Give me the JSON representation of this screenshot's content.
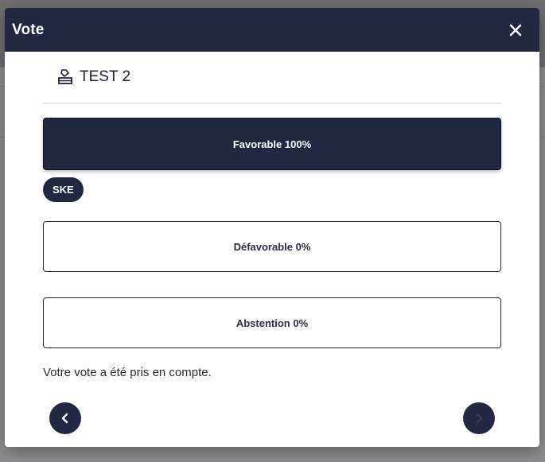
{
  "dialog": {
    "title": "Vote",
    "close_icon": "close-icon"
  },
  "question": {
    "icon": "ballot-box-icon",
    "title": "TEST 2"
  },
  "options": [
    {
      "label": "Favorable 100%",
      "selected": true
    },
    {
      "label": "Défavorable 0%",
      "selected": false
    },
    {
      "label": "Abstention 0%",
      "selected": false
    }
  ],
  "voter_badge": "SKE",
  "confirmation": "Votre vote a été pris en compte.",
  "navigation": {
    "prev_icon": "chevron-left-icon",
    "next_icon": "chevron-right-icon",
    "next_enabled": false
  },
  "colors": {
    "primary": "#232742",
    "white": "#ffffff"
  }
}
